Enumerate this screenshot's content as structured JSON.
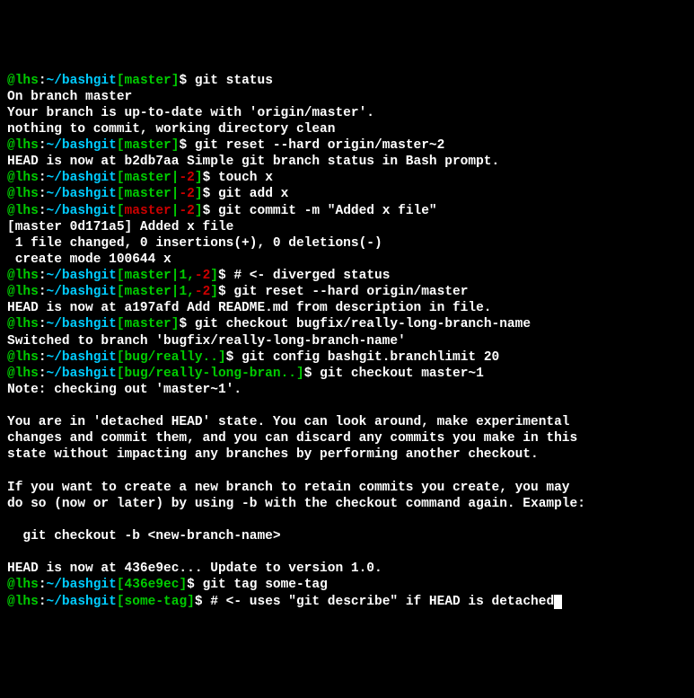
{
  "lines": [
    {
      "type": "prompt",
      "user": "@lhs",
      "path": "~/bashgit",
      "branch": "master",
      "branchColor": "green",
      "nums": [],
      "cmd": "git status"
    },
    {
      "type": "out",
      "text": "On branch master"
    },
    {
      "type": "out",
      "text": "Your branch is up-to-date with 'origin/master'."
    },
    {
      "type": "out",
      "text": "nothing to commit, working directory clean"
    },
    {
      "type": "prompt",
      "user": "@lhs",
      "path": "~/bashgit",
      "branch": "master",
      "branchColor": "green",
      "nums": [],
      "cmd": "git reset --hard origin/master~2"
    },
    {
      "type": "out",
      "text": "HEAD is now at b2db7aa Simple git branch status in Bash prompt."
    },
    {
      "type": "prompt",
      "user": "@lhs",
      "path": "~/bashgit",
      "branch": "master",
      "branchColor": "green",
      "nums": [
        {
          "text": "-2",
          "color": "red"
        }
      ],
      "cmd": "touch x"
    },
    {
      "type": "prompt",
      "user": "@lhs",
      "path": "~/bashgit",
      "branch": "master",
      "branchColor": "green",
      "nums": [
        {
          "text": "-2",
          "color": "red"
        }
      ],
      "cmd": "git add x"
    },
    {
      "type": "prompt",
      "user": "@lhs",
      "path": "~/bashgit",
      "branch": "master",
      "branchColor": "red",
      "nums": [
        {
          "text": "-2",
          "color": "red"
        }
      ],
      "cmd": "git commit -m \"Added x file\""
    },
    {
      "type": "out",
      "text": "[master 0d171a5] Added x file"
    },
    {
      "type": "out",
      "text": " 1 file changed, 0 insertions(+), 0 deletions(-)"
    },
    {
      "type": "out",
      "text": " create mode 100644 x"
    },
    {
      "type": "prompt",
      "user": "@lhs",
      "path": "~/bashgit",
      "branch": "master",
      "branchColor": "green",
      "nums": [
        {
          "text": "1",
          "color": "green"
        },
        {
          "text": "-2",
          "color": "red"
        }
      ],
      "cmd": "# <- diverged status"
    },
    {
      "type": "prompt",
      "user": "@lhs",
      "path": "~/bashgit",
      "branch": "master",
      "branchColor": "green",
      "nums": [
        {
          "text": "1",
          "color": "green"
        },
        {
          "text": "-2",
          "color": "red"
        }
      ],
      "cmd": "git reset --hard origin/master"
    },
    {
      "type": "out",
      "text": "HEAD is now at a197afd Add README.md from description in file."
    },
    {
      "type": "prompt",
      "user": "@lhs",
      "path": "~/bashgit",
      "branch": "master",
      "branchColor": "green",
      "nums": [],
      "cmd": "git checkout bugfix/really-long-branch-name"
    },
    {
      "type": "out",
      "text": "Switched to branch 'bugfix/really-long-branch-name'"
    },
    {
      "type": "prompt",
      "user": "@lhs",
      "path": "~/bashgit",
      "branch": "bug/really..",
      "branchColor": "green",
      "nums": [],
      "cmd": "git config bashgit.branchlimit 20"
    },
    {
      "type": "prompt",
      "user": "@lhs",
      "path": "~/bashgit",
      "branch": "bug/really-long-bran..",
      "branchColor": "green",
      "nums": [],
      "cmd": "git checkout master~1"
    },
    {
      "type": "out",
      "text": "Note: checking out 'master~1'."
    },
    {
      "type": "out",
      "text": ""
    },
    {
      "type": "out",
      "text": "You are in 'detached HEAD' state. You can look around, make experimental"
    },
    {
      "type": "out",
      "text": "changes and commit them, and you can discard any commits you make in this"
    },
    {
      "type": "out",
      "text": "state without impacting any branches by performing another checkout."
    },
    {
      "type": "out",
      "text": ""
    },
    {
      "type": "out",
      "text": "If you want to create a new branch to retain commits you create, you may"
    },
    {
      "type": "out",
      "text": "do so (now or later) by using -b with the checkout command again. Example:"
    },
    {
      "type": "out",
      "text": ""
    },
    {
      "type": "out",
      "text": "  git checkout -b <new-branch-name>"
    },
    {
      "type": "out",
      "text": ""
    },
    {
      "type": "out",
      "text": "HEAD is now at 436e9ec... Update to version 1.0."
    },
    {
      "type": "prompt",
      "user": "@lhs",
      "path": "~/bashgit",
      "branch": "436e9ec",
      "branchColor": "green",
      "nums": [],
      "cmd": "git tag some-tag"
    },
    {
      "type": "prompt",
      "user": "@lhs",
      "path": "~/bashgit",
      "branch": "some-tag",
      "branchColor": "green",
      "nums": [],
      "cmd": "# <- uses \"git describe\" if HEAD is detached",
      "cursor": true
    }
  ]
}
